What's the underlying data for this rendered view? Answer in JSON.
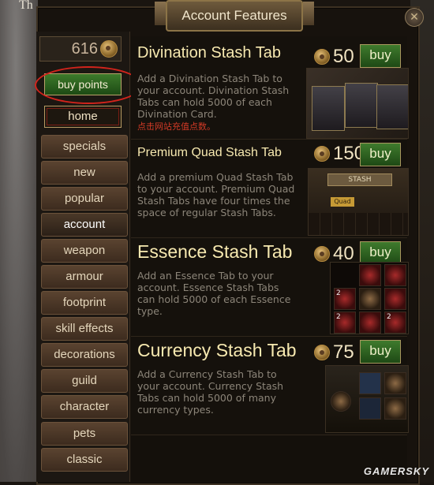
{
  "window": {
    "title": "Account Features",
    "bg_text": "Th"
  },
  "points": {
    "value": "616"
  },
  "sidebar": {
    "buy_points_label": "buy points",
    "home_label": "home",
    "items": [
      {
        "label": "specials"
      },
      {
        "label": "new"
      },
      {
        "label": "popular"
      },
      {
        "label": "account",
        "active": true
      },
      {
        "label": "weapon"
      },
      {
        "label": "armour"
      },
      {
        "label": "footprint"
      },
      {
        "label": "skill effects"
      },
      {
        "label": "decorations"
      },
      {
        "label": "guild"
      },
      {
        "label": "character"
      },
      {
        "label": "pets"
      },
      {
        "label": "classic"
      }
    ]
  },
  "products": [
    {
      "title": "Divination Stash Tab",
      "price": "50",
      "buy_label": "buy",
      "description": "Add a Divination Stash Tab to your account. Divination Stash Tabs can hold 5000 of each Divination Card.",
      "note": "点击网站充值点数。"
    },
    {
      "title": "Premium Quad Stash Tab",
      "price": "150",
      "buy_label": "buy",
      "description": "Add a premium Quad Stash Tab to your account. Premium Quad Stash Tabs have four times the space of regular Stash Tabs.",
      "art_labels": {
        "stash": "STASH",
        "quad": "Quad"
      }
    },
    {
      "title": "Essence Stash Tab",
      "price": "40",
      "buy_label": "buy",
      "description": "Add an Essence Tab to your account. Essence Stash Tabs can hold 5000 of each Essence type."
    },
    {
      "title": "Currency Stash Tab",
      "price": "75",
      "buy_label": "buy",
      "description": "Add a Currency Stash Tab to your account. Currency Stash Tabs can hold 5000 of many currency types."
    }
  ],
  "watermark": "GAMERSKY",
  "colors": {
    "buy_green": "#2f6a22",
    "title_gold": "#f7e9b0",
    "highlight_red": "#d1241c"
  }
}
